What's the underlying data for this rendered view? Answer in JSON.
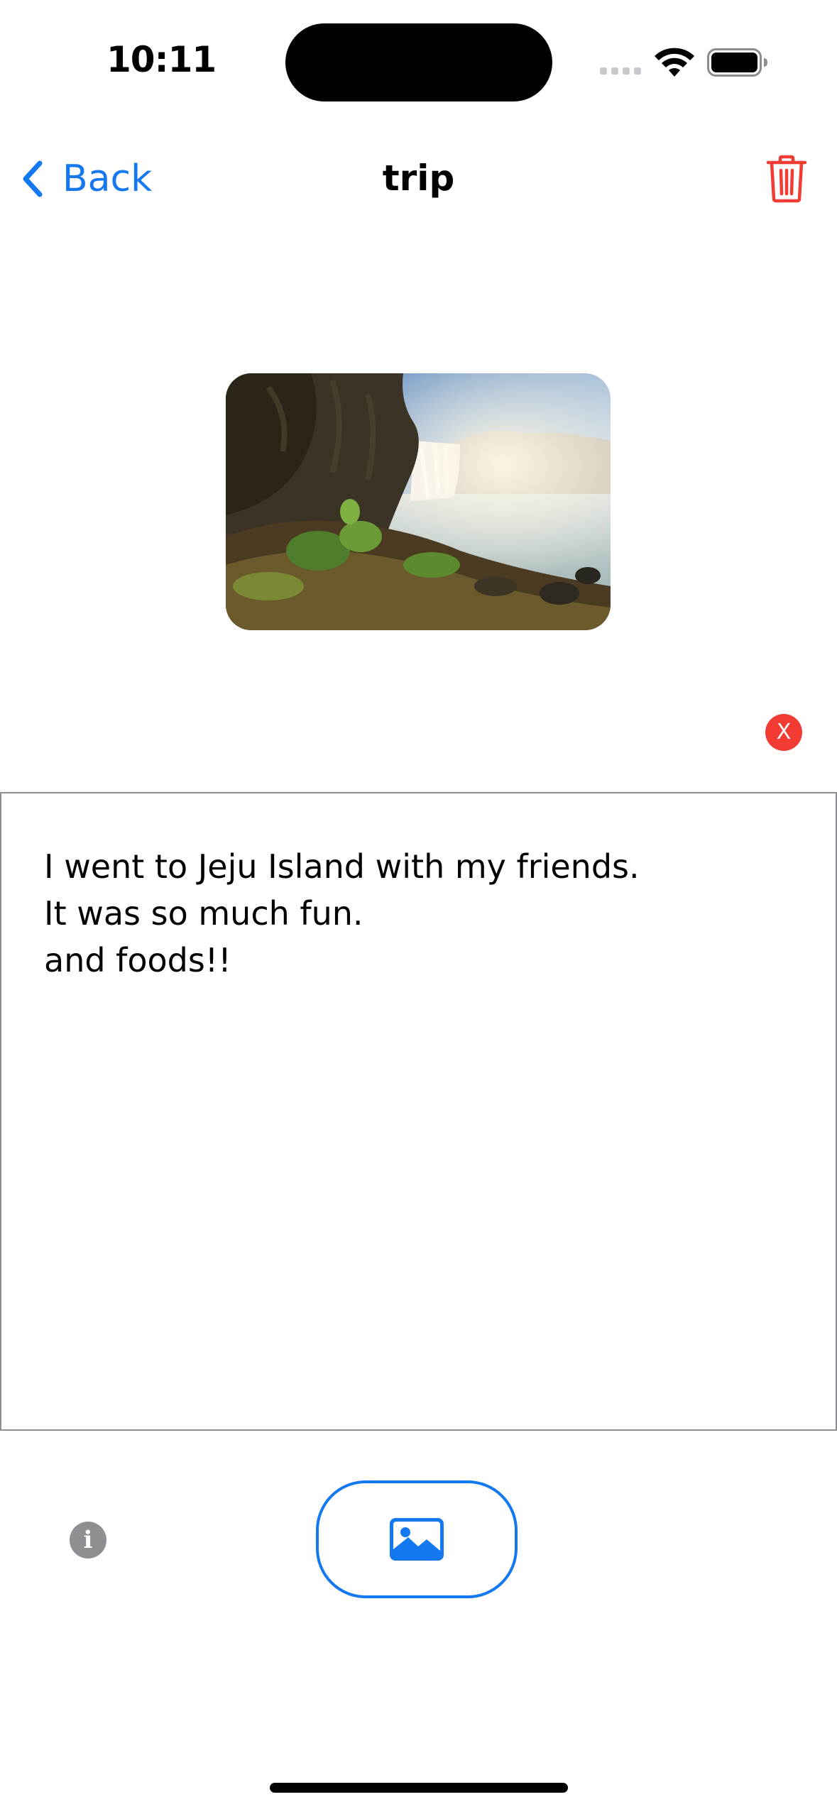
{
  "status_bar": {
    "time": "10:11"
  },
  "nav": {
    "back_label": "Back",
    "title": "trip"
  },
  "photo": {
    "remove_label": "X"
  },
  "memo": {
    "text": "I went to Jeju Island with my friends.\nIt was so much fun.\nand foods!!"
  },
  "bottom": {
    "info_glyph": "i"
  },
  "icons": {
    "back": "chevron-left-icon",
    "delete": "trash-icon",
    "info": "info-icon",
    "add_photo": "photo-icon"
  },
  "colors": {
    "accent": "#1478f0",
    "destructive": "#f23b32",
    "gray": "#8e8e93"
  }
}
